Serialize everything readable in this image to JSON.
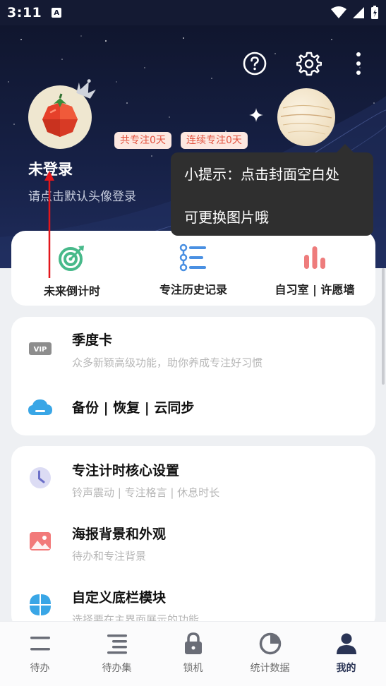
{
  "status_bar": {
    "time": "3:11",
    "a_icon": "A"
  },
  "header": {
    "icons": [
      "help-icon",
      "gear-icon",
      "more-vertical-icon"
    ],
    "user_name": "未登录",
    "login_hint": "请点击默认头像登录",
    "badge_total": "共专注0天",
    "badge_streak": "连续专注0天"
  },
  "tooltip": {
    "line1": "小提示：点击封面空白处",
    "line2": "可更换图片哦"
  },
  "quick_actions": [
    {
      "label": "未来倒计时",
      "icon": "target-icon"
    },
    {
      "label": "专注历史记录",
      "icon": "list-icon"
    },
    {
      "label": "自习室 | 许愿墙",
      "icon": "bar-chart-icon"
    }
  ],
  "card1": {
    "vip_badge": "VIP",
    "items": [
      {
        "title": "季度卡",
        "subtitle": "众多新颖高级功能，助你养成专注好习惯"
      },
      {
        "title": "备份 | 恢复 | 云同步",
        "subtitle": ""
      }
    ]
  },
  "card2": {
    "items": [
      {
        "title": "专注计时核心设置",
        "subtitle": "铃声震动 | 专注格言 | 休息时长"
      },
      {
        "title": "海报背景和外观",
        "subtitle": "待办和专注背景"
      },
      {
        "title": "自定义底栏模块",
        "subtitle": "选择要在主界面展示的功能"
      }
    ]
  },
  "bottom_nav": [
    {
      "label": "待办",
      "icon": "todo-icon"
    },
    {
      "label": "待办集",
      "icon": "todo-set-icon"
    },
    {
      "label": "锁机",
      "icon": "lock-icon"
    },
    {
      "label": "统计数据",
      "icon": "pie-chart-icon"
    },
    {
      "label": "我的",
      "icon": "person-icon",
      "active": true
    }
  ],
  "colors": {
    "hero_dark": "#10162e",
    "accent_red": "#e2523f",
    "badge_bg": "#fde8e1",
    "nav_active": "#2a3455",
    "green_icon": "#47b98a",
    "blue_icon": "#4a90e2",
    "pink_icon": "#ee7c7c"
  }
}
